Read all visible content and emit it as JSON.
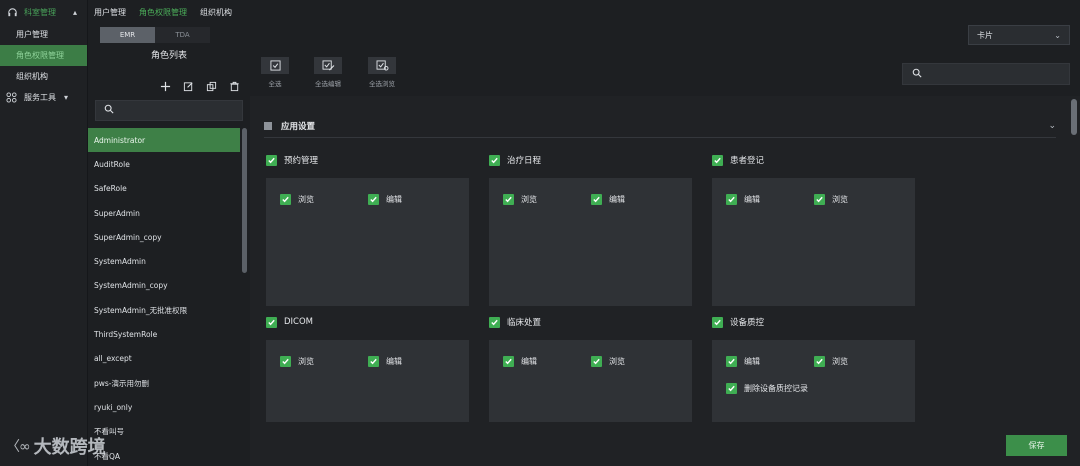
{
  "nav": {
    "section1": "科室管理",
    "items": [
      "用户管理",
      "角色权限管理",
      "组织机构"
    ],
    "section2": "服务工具"
  },
  "top_tabs": [
    "用户管理",
    "角色权限管理",
    "组织机构"
  ],
  "sub_tabs": [
    "EMR",
    "TDA"
  ],
  "view_select": "卡片",
  "roles": {
    "title": "角色列表",
    "items": [
      "Administrator",
      "AuditRole",
      "SafeRole",
      "SuperAdmin",
      "SuperAdmin_copy",
      "SystemAdmin",
      "SystemAdmin_copy",
      "SystemAdmin_无批准权限",
      "ThirdSystemRole",
      "all_except",
      "pws-演示用勿删",
      "ryuki_only",
      "不看叫号",
      "不看QA"
    ]
  },
  "toolbar": {
    "select_all": "全选",
    "select_all_edit": "全选编辑",
    "select_all_view": "全选浏览"
  },
  "section": {
    "title": "应用设置"
  },
  "modules": [
    {
      "name": "预约管理",
      "perms": [
        "浏览",
        "编辑"
      ]
    },
    {
      "name": "治疗日程",
      "perms": [
        "浏览",
        "编辑"
      ]
    },
    {
      "name": "患者登记",
      "perms": [
        "编辑",
        "浏览"
      ]
    },
    {
      "name": "DICOM",
      "perms": [
        "浏览",
        "编辑"
      ]
    },
    {
      "name": "临床处置",
      "perms": [
        "编辑",
        "浏览"
      ]
    },
    {
      "name": "设备质控",
      "perms": [
        "编辑",
        "浏览",
        "删除设备质控记录"
      ]
    }
  ],
  "save_label": "保存",
  "watermark": "大数跨境",
  "colors": {
    "accent": "#3fae53",
    "active_bg": "#3e8047"
  }
}
